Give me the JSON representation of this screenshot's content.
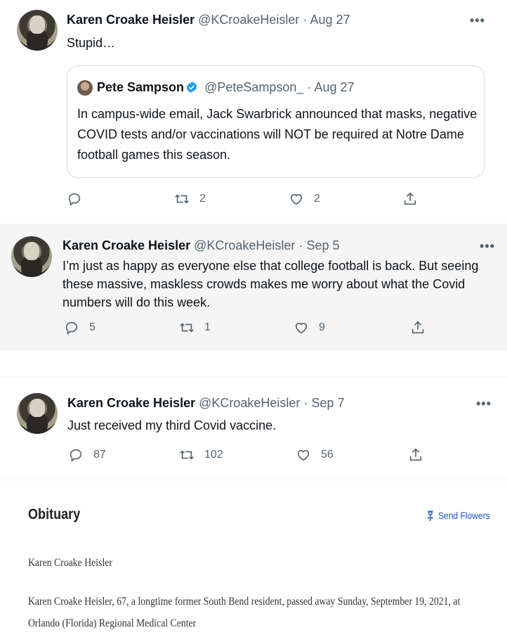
{
  "tweets": [
    {
      "name": "Karen Croake Heisler",
      "handle": "@KCroakeHeisler",
      "dot": "·",
      "date": "Aug 27",
      "text": "Stupid…",
      "more": "•••",
      "quote": {
        "name": "Pete Sampson",
        "handle": "@PeteSampson_",
        "dot": "·",
        "date": "Aug 27",
        "text": "In campus-wide email, Jack Swarbrick announced that masks, negative COVID tests and/or vaccinations will NOT be required at Notre Dame football games this season."
      },
      "replies": "",
      "retweets": "2",
      "likes": "2"
    },
    {
      "name": "Karen Croake Heisler",
      "handle": "@KCroakeHeisler",
      "dot": "·",
      "date": "Sep 5",
      "text": "I’m just as happy as everyone else that college football is back. But seeing these massive, maskless crowds makes me worry about what the Covid numbers will do this week.",
      "more": "•••",
      "replies": "5",
      "retweets": "1",
      "likes": "9"
    },
    {
      "name": "Karen Croake Heisler",
      "handle": "@KCroakeHeisler",
      "dot": "·",
      "date": "Sep 7",
      "text": "Just received my third Covid vaccine.",
      "more": "•••",
      "replies": "87",
      "retweets": "102",
      "likes": "56"
    }
  ],
  "icons": {
    "reply": "reply-icon",
    "retweet": "retweet-icon",
    "like": "heart-icon",
    "share": "share-icon",
    "verified": "verified-badge-icon",
    "flowers": "flower-icon"
  },
  "colors": {
    "verified": "#1d9bf0",
    "highlight_bg": "#f5f5f5",
    "link": "#1a56b8"
  },
  "obituary": {
    "title": "Obituary",
    "send_flowers": "Send Flowers",
    "name": "Karen Croake Heisler",
    "body": "Karen Croake Heisler, 67, a longtime former South Bend resident, passed away Sunday, September 19, 2021, at Orlando (Florida) Regional Medical Center"
  }
}
